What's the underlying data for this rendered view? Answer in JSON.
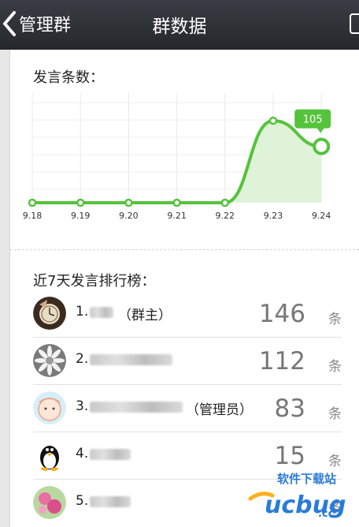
{
  "header": {
    "back_label": "管理群",
    "title": "群数据"
  },
  "chart_section": {
    "title": "发言条数："
  },
  "chart_data": {
    "type": "area",
    "categories": [
      "9.18",
      "9.19",
      "9.20",
      "9.21",
      "9.22",
      "9.23",
      "9.24"
    ],
    "values": [
      0,
      0,
      0,
      0,
      0,
      153,
      105
    ],
    "tooltip_value": "105",
    "grid": true,
    "line_color": "#55c33c",
    "fill_color": "#dff3d8"
  },
  "ranking_section": {
    "title": "近7天发言排行榜：",
    "unit": "条",
    "items": [
      {
        "rank": "1.",
        "role": "（群主）",
        "count": "146"
      },
      {
        "rank": "2.",
        "role": "",
        "count": "112"
      },
      {
        "rank": "3.",
        "role": "（管理员）",
        "count": "83"
      },
      {
        "rank": "4.",
        "role": "",
        "count": "15"
      },
      {
        "rank": "5.",
        "role": "",
        "count": ""
      }
    ]
  },
  "watermark": {
    "brand": "ucbug",
    "cn": "软件下载站",
    "cc": ".cc",
    "icon": "ucbug-logo"
  }
}
